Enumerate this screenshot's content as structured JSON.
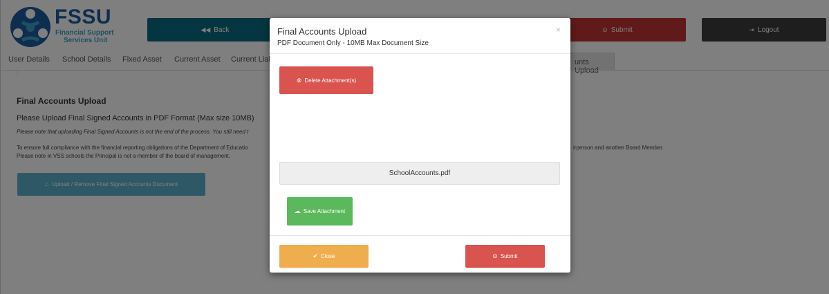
{
  "header": {
    "logo_title": "FSSU",
    "logo_sub1": "Financial Support",
    "logo_sub2": "Services Unit",
    "back_label": "Back",
    "submit_label": "Submit",
    "logout_label": "Logout"
  },
  "tabs": [
    {
      "label": "User Details"
    },
    {
      "label": "School Details"
    },
    {
      "label": "Fixed Asset"
    },
    {
      "label": "Current Asset"
    },
    {
      "label": "Current Liab"
    },
    {
      "label": "unts Upload"
    }
  ],
  "content": {
    "title": "Final Accounts Upload",
    "p1": "Please Upload Final Signed Accounts in PDF Format (Max size 10MB)",
    "p2": "Please note that uploading Final Signed Accounts is not the end of the process. You still need t",
    "p3": "To ensure full compliance with the financial reporting obligations of the Department of Educatio",
    "p3_tail": "irperson and another Board Member.",
    "p4": "Please note in VSS schools the Principal is not a member of the board of management.",
    "upload_button": "Upload / Remove Final Signed Accounts Document"
  },
  "modal": {
    "title": "Final Accounts Upload",
    "subtitle": "PDF Document Only - 10MB Max Document Size",
    "close_x": "×",
    "delete_label": "Delete Attachment(s)",
    "file_name": "SchoolAccounts.pdf",
    "save_label": "Save Attachment",
    "close_label": "Close",
    "submit_label": "Submit"
  },
  "colors": {
    "back": "#0b6b80",
    "submit": "#c13433",
    "logout": "#3d3d3d",
    "danger": "#d9534f",
    "success": "#5cb85c",
    "warning": "#f0ad4e",
    "info": "#5fb1ce"
  },
  "icons": {
    "back": "double-left-arrow-icon",
    "submit": "circle-arrow-up-icon",
    "logout": "sign-out-icon",
    "upload": "home-icon",
    "delete": "remove-circle-icon",
    "save": "cloud-upload-icon",
    "close": "check-icon"
  }
}
